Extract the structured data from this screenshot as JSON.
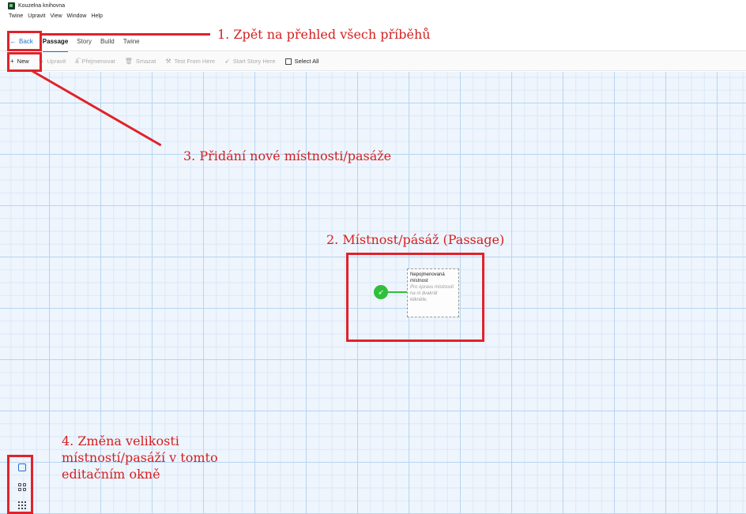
{
  "window": {
    "title": "Kouzelna knihovna"
  },
  "menubar": [
    "Twine",
    "Upravit",
    "View",
    "Window",
    "Help"
  ],
  "tabs": {
    "back_label": "Back",
    "items": [
      "Passage",
      "Story",
      "Build",
      "Twine"
    ],
    "active": "Passage"
  },
  "toolbar": {
    "new": "New",
    "edit": "Upravit",
    "rename": "Přejmenovat",
    "delete": "Smazat",
    "test": "Test From Here",
    "start": "Start Story Here",
    "select_all": "Select All"
  },
  "passage": {
    "title": "Nepojmenovaná místnost",
    "excerpt": "Pro úpravu místnosti na ni dvakrát klikněte."
  },
  "annotations": {
    "a1": "1. Zpět na přehled všech příběhů",
    "a2": "2. Místnost/pásáž (Passage)",
    "a3": "3. Přidání nové místnosti/pasáže",
    "a4": "4. Změna velikosti místností/pasáží v tomto editačním okně"
  },
  "colors": {
    "accent": "#1f73d0",
    "annotation": "#e0222a",
    "start": "#2fbf3a",
    "grid": "#eef5fd"
  }
}
